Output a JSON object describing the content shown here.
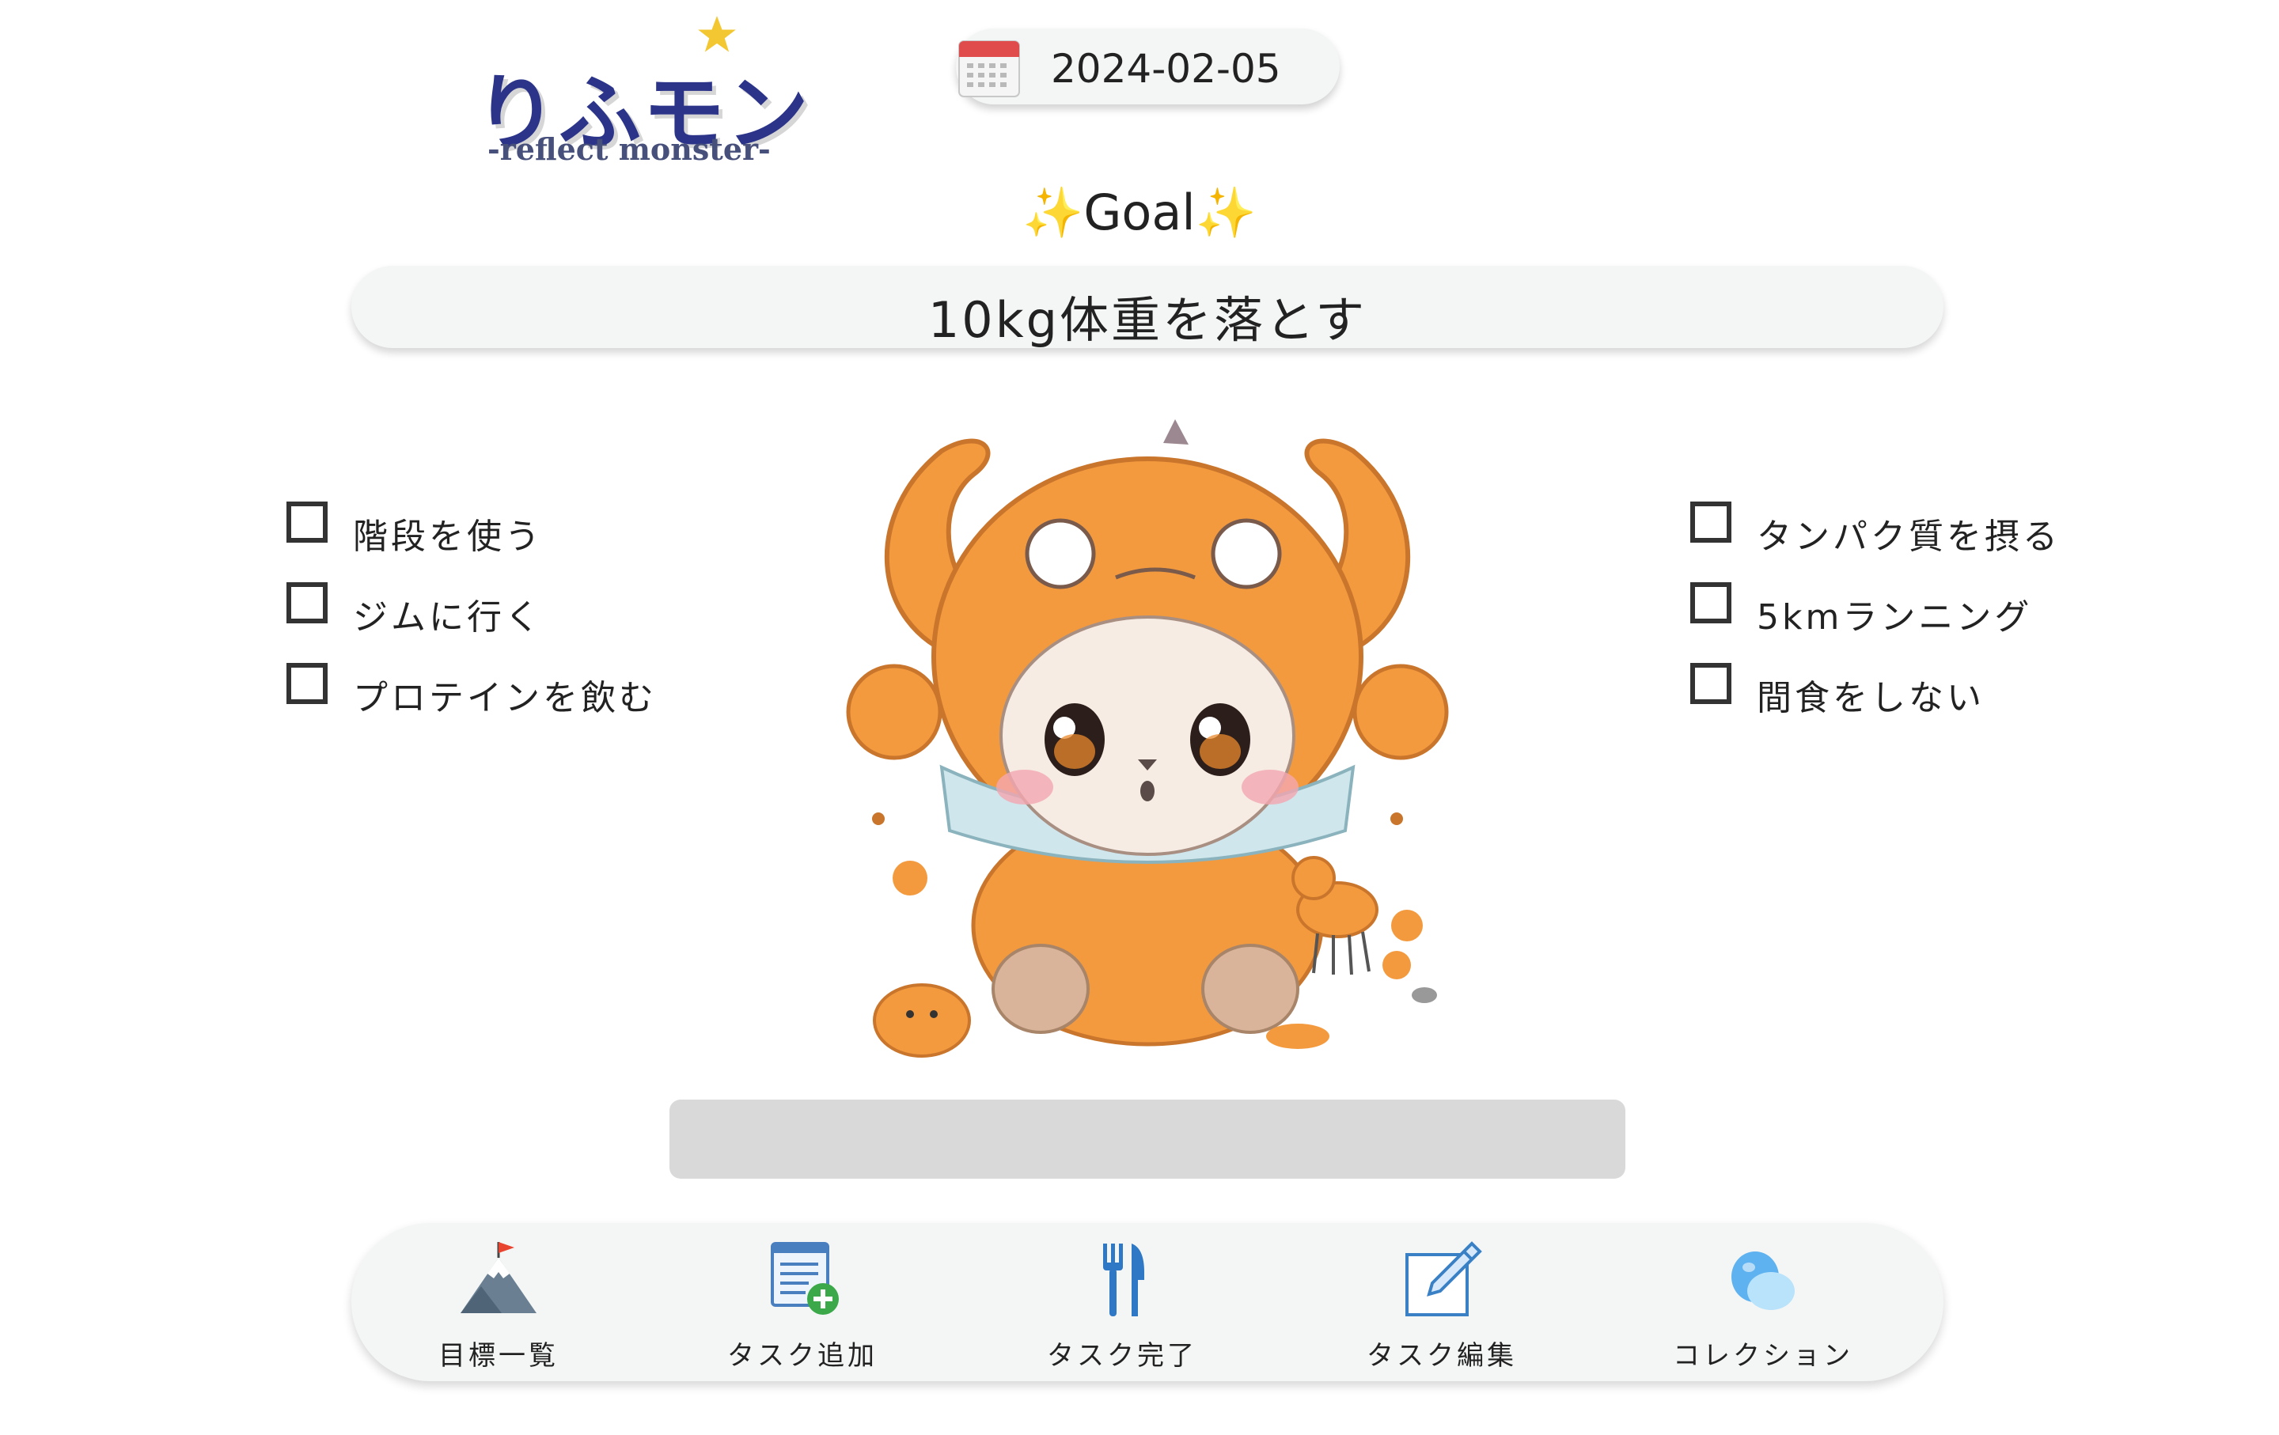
{
  "app": {
    "logo_title": "りふモン",
    "logo_subtitle": "-reflect monster-"
  },
  "date": {
    "value": "2024-02-05",
    "icon": "calendar-icon"
  },
  "goal": {
    "heading_prefix": "✨",
    "heading": "Goal",
    "heading_suffix": "✨",
    "text": "10kg体重を落とす"
  },
  "tasks_left": [
    {
      "label": "階段を使う",
      "checked": false
    },
    {
      "label": "ジムに行く",
      "checked": false
    },
    {
      "label": "プロテインを飲む",
      "checked": false
    }
  ],
  "tasks_right": [
    {
      "label": "タンパク質を摂る",
      "checked": false
    },
    {
      "label": "5kmランニング",
      "checked": false
    },
    {
      "label": "間食をしない",
      "checked": false
    }
  ],
  "progress": {
    "value": 0
  },
  "nav": [
    {
      "label": "目標一覧",
      "icon": "mountain-flag-icon"
    },
    {
      "label": "タスク追加",
      "icon": "add-task-icon"
    },
    {
      "label": "タスク完了",
      "icon": "fork-knife-icon"
    },
    {
      "label": "タスク編集",
      "icon": "edit-pencil-icon"
    },
    {
      "label": "コレクション",
      "icon": "collection-bubbles-icon"
    }
  ],
  "colors": {
    "logo": "#2b3489",
    "monster_orange": "#f39a3f",
    "pill_bg": "#f4f6f5",
    "progress_track": "#d9d9d9"
  }
}
